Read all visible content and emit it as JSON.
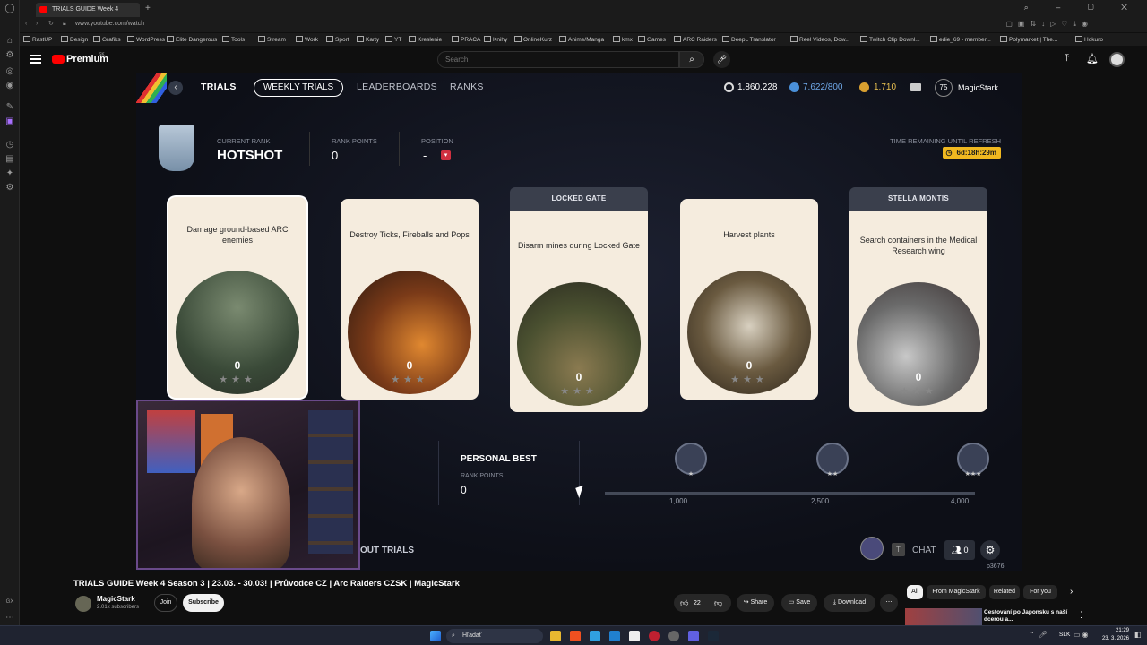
{
  "browser": {
    "tab_title": "TRIALS GUIDE Week 4",
    "url": "www.youtube.com/watch",
    "bookmarks": [
      "RastUP",
      "Design",
      "Grafiks",
      "WordPress",
      "Elite Dangerous",
      "Tools",
      "Stream",
      "Work",
      "Sport",
      "Karty",
      "YT",
      "Kreslenie",
      "PRACA",
      "Knihy",
      "OnlineKurz",
      "Anime/Manga",
      "kmx",
      "Games",
      "ARC Raiders",
      "DeepL Translator",
      "Reel Videos, Dow...",
      "Twitch Clip Downl...",
      "edie_69 - member...",
      "Polymarket | The...",
      "Hokuro"
    ]
  },
  "youtube": {
    "logo": "Premium",
    "region": "SK",
    "search_placeholder": "Search"
  },
  "game": {
    "nav": {
      "trials": "TRIALS",
      "weekly": "WEEKLY TRIALS",
      "leaderboards": "LEADERBOARDS",
      "ranks": "RANKS"
    },
    "currency": {
      "coins": "1.860.228",
      "cred": "7.622/800",
      "tokens": "1.710"
    },
    "player": {
      "level": "75",
      "name": "MagicStark"
    },
    "rank": {
      "current_label": "CURRENT RANK",
      "current_value": "HOTSHOT",
      "points_label": "RANK POINTS",
      "points_value": "0",
      "position_label": "POSITION",
      "position_value": "-"
    },
    "timer": {
      "label": "TIME REMAINING UNTIL REFRESH",
      "value": "6d:18h:29m"
    },
    "trials": [
      {
        "header": "",
        "title": "Damage ground-based ARC enemies",
        "score": "0"
      },
      {
        "header": "",
        "title": "Destroy Ticks, Fireballs and Pops",
        "score": "0"
      },
      {
        "header": "LOCKED GATE",
        "title": "Disarm mines during Locked Gate",
        "score": "0"
      },
      {
        "header": "",
        "title": "Harvest plants",
        "score": "0"
      },
      {
        "header": "STELLA MONTIS",
        "title": "Search containers in the Medical Research wing",
        "score": "0"
      }
    ],
    "personal_best": {
      "title": "PERSONAL BEST",
      "label": "RANK POINTS",
      "value": "0"
    },
    "thresholds": [
      "1,000",
      "2,500",
      "4,000"
    ],
    "about": "OUT TRIALS",
    "chat": {
      "t": "T",
      "label": "CHAT",
      "friends": "0"
    },
    "build": "p3676"
  },
  "video": {
    "title": "TRIALS GUIDE Week 4 Season 3 | 23.03. - 30.03! | Průvodce CZ | Arc Raiders CZSK | MagicStark",
    "channel": "MagicStark",
    "subs": "2.01k subscribers",
    "join": "Join",
    "subscribe": "Subscribe",
    "likes": "22",
    "share": "Share",
    "save": "Save",
    "download": "Download",
    "filters": [
      "All",
      "From MagicStark",
      "Related",
      "For you"
    ],
    "rec_title": "Cestování po Japonsku s naší dcerou a..."
  },
  "taskbar": {
    "search": "Hľadať",
    "lang": "SLK",
    "time": "21:29",
    "date": "23. 3. 2026"
  }
}
